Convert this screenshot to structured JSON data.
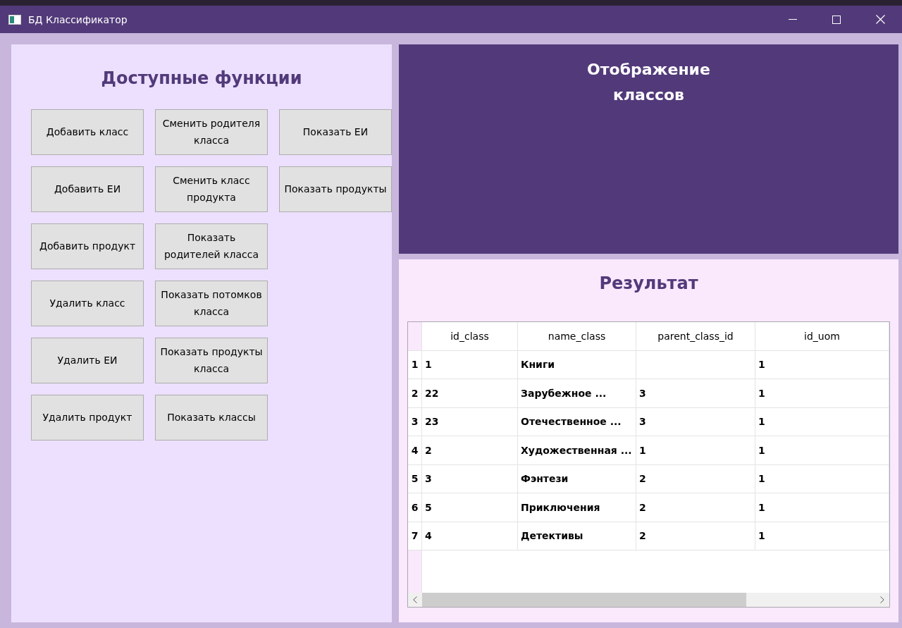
{
  "window": {
    "title": "БД Классификатор"
  },
  "functions": {
    "title": "Доступные функции",
    "button_rows": [
      [
        "Добавить класс",
        "Сменить родителя класса",
        "Показать ЕИ"
      ],
      [
        "Добавить ЕИ",
        "Сменить класс продукта",
        "Показать продукты"
      ],
      [
        "Добавить продукт",
        "Показать родителей класса"
      ],
      [
        "Удалить класс",
        "Показать потомков класса"
      ],
      [
        "Удалить ЕИ",
        "Показать продукты класса"
      ],
      [
        "Удалить продукт",
        "Показать классы"
      ]
    ]
  },
  "class_view": {
    "title": "Отображение классов"
  },
  "result": {
    "title": "Результат",
    "table": {
      "columns": [
        "id_class",
        "name_class",
        "parent_class_id",
        "id_uom"
      ],
      "rows": [
        {
          "number": "1",
          "cells": [
            "1",
            "Книги",
            "",
            "1"
          ]
        },
        {
          "number": "2",
          "cells": [
            "22",
            "Зарубежное ...",
            "3",
            "1"
          ]
        },
        {
          "number": "3",
          "cells": [
            "23",
            "Отечественное ...",
            "3",
            "1"
          ]
        },
        {
          "number": "4",
          "cells": [
            "2",
            "Художественная ...",
            "1",
            "1"
          ]
        },
        {
          "number": "5",
          "cells": [
            "3",
            "Фэнтези",
            "2",
            "1"
          ]
        },
        {
          "number": "6",
          "cells": [
            "5",
            "Приключения",
            "2",
            "1"
          ]
        },
        {
          "number": "7",
          "cells": [
            "4",
            "Детективы",
            "2",
            "1"
          ]
        }
      ]
    }
  }
}
